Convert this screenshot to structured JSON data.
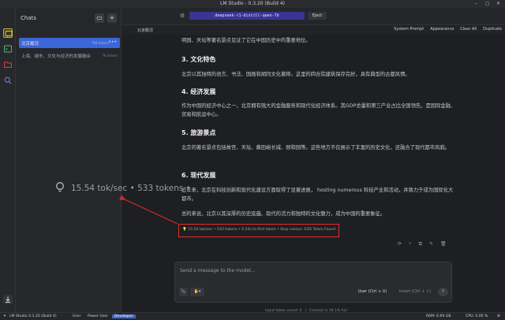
{
  "window": {
    "title": "LM Studio - 0.3.20 (Build 4)"
  },
  "sidebar": {
    "title": "Chats",
    "chats": [
      {
        "name": "北京概况",
        "size": "768 tokens"
      },
      {
        "name": "上海、城市、文化与经济的发展融合",
        "size": "76 tokens"
      }
    ]
  },
  "topbar": {
    "model": "deepseek-r1-distill-qwen-7b",
    "eject_label": "Eject"
  },
  "tabs": {
    "active": "北京概况"
  },
  "actions": {
    "system_prompt": "System Prompt",
    "appearance": "Appearance",
    "clear_all": "Clear All",
    "duplicate": "Duplicate"
  },
  "message": {
    "intro": "明园、天坛等著名景点见证了它在中国历史中的重要地位。",
    "sections": [
      {
        "heading": "3. 文化特色",
        "body": "北京以其独特的语言、书法、国画和胡同文化著称。这里的四合院建筑保存完好，具有典型的古都风情。"
      },
      {
        "heading": "4. 经济发展",
        "body": "作为中国的经济中心之一，北京拥有强大的金融服务和现代化经济体系。其GDP总量和第三产业占比全国领先，是国际金融、贸易和航运中心。"
      },
      {
        "heading": "5. 旅游景点",
        "body": "北京的著名景点包括故宫、天坛、慕田峪长城、颐和园等。这些地方不仅展示了丰富的历史文化，还融合了现代都市风貌。"
      },
      {
        "heading": "6. 现代发展",
        "body": "近年来，北京在科技创新和现代化建设方面取得了显著进展， hosting numerous 科技产业和活动，并致力于成为国际化大都市。"
      }
    ],
    "conclusion": "总的来说，北京以其深厚的历史底蕴、现代的活力和独特的文化魅力，成为中国的重要象征。",
    "stats": "15.54 tok/sec • 533 tokens • 0.24s to first token • Stop reason: EOS Token Found"
  },
  "overlay": {
    "text": "15.54 tok/sec • 533 tokens •"
  },
  "composer": {
    "placeholder": "Send a message to the model...",
    "user_button": "User (Ctrl + U)",
    "insert_button": "Insert (Ctrl + ⇧)",
    "input_token_count": "Input token count:  0",
    "context": "Context is 19.1% full"
  },
  "statusbar": {
    "app": "LM Studio 0.3.20 (Build 4)",
    "user": "User",
    "power_user": "Power User",
    "developer": "Developer",
    "ram": "RAM: 6.69 GB",
    "cpu": "CPU: 0.00 %"
  },
  "colors": {
    "accent": "#3a3494",
    "highlight": "#e02d2d",
    "selected_chat": "#3b66d9"
  }
}
